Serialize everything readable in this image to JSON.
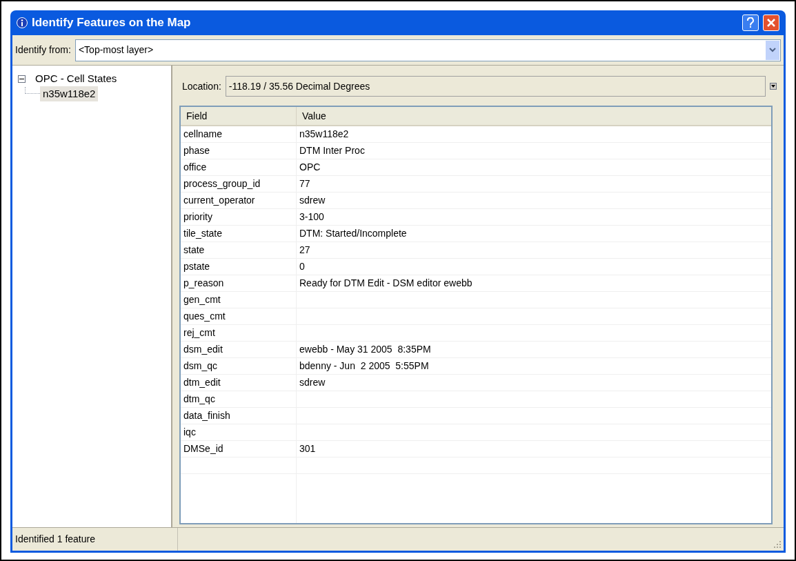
{
  "window": {
    "title": "Identify Features on the Map"
  },
  "identify_from": {
    "label": "Identify from:",
    "value": "<Top-most layer>"
  },
  "tree": [
    {
      "label": "OPC - Cell States",
      "expanded": true,
      "selected": false,
      "children": [
        {
          "label": "n35w118e2",
          "selected": true
        }
      ]
    }
  ],
  "location": {
    "label": "Location:",
    "value": "-118.19 / 35.56 Decimal Degrees"
  },
  "table": {
    "columns": [
      "Field",
      "Value"
    ],
    "rows": [
      {
        "field": "cellname",
        "value": "n35w118e2"
      },
      {
        "field": "phase",
        "value": "DTM Inter Proc"
      },
      {
        "field": "office",
        "value": "OPC"
      },
      {
        "field": "process_group_id",
        "value": "77"
      },
      {
        "field": "current_operator",
        "value": "sdrew"
      },
      {
        "field": "priority",
        "value": "3-100"
      },
      {
        "field": "tile_state",
        "value": "DTM: Started/Incomplete"
      },
      {
        "field": "state",
        "value": "27"
      },
      {
        "field": "pstate",
        "value": "0"
      },
      {
        "field": "p_reason",
        "value": "Ready for DTM Edit - DSM editor ewebb"
      },
      {
        "field": "gen_cmt"
      },
      {
        "field": "ques_cmt"
      },
      {
        "field": "rej_cmt"
      },
      {
        "field": "dsm_edit",
        "value": "ewebb - May 31 2005  8:35PM"
      },
      {
        "field": "dsm_qc",
        "value": "bdenny - Jun  2 2005  5:55PM"
      },
      {
        "field": "dtm_edit",
        "value": "sdrew"
      },
      {
        "field": "dtm_qc"
      },
      {
        "field": "data_finish"
      },
      {
        "field": "iqc"
      },
      {
        "field": "DMSe_id",
        "value": "301"
      }
    ]
  },
  "status_bar": "Identified 1 feature"
}
